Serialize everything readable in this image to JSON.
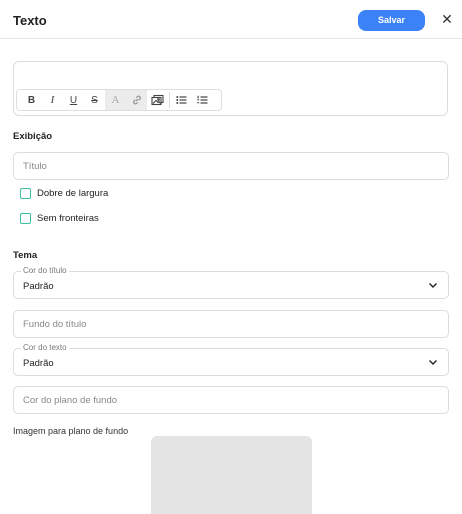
{
  "header": {
    "title": "Texto",
    "save_label": "Salvar",
    "close_glyph": "✕"
  },
  "toolbar": {
    "items": [
      {
        "name": "bold-icon",
        "glyph": "B"
      },
      {
        "name": "italic-icon",
        "glyph": "I"
      },
      {
        "name": "underline-icon",
        "glyph": "U"
      },
      {
        "name": "strikethrough-icon",
        "glyph": "S"
      },
      {
        "name": "text-color-icon",
        "glyph": "A"
      },
      {
        "name": "link-icon",
        "glyph": ""
      },
      {
        "name": "image-icon",
        "glyph": ""
      },
      {
        "name": "bullet-list-icon",
        "glyph": ""
      },
      {
        "name": "numbered-list-icon",
        "glyph": ""
      }
    ]
  },
  "display": {
    "label": "Exibição",
    "title_placeholder": "Título",
    "options": [
      {
        "label": "Dobre de largura",
        "checked": false
      },
      {
        "label": "Sem fronteiras",
        "checked": false
      }
    ]
  },
  "theme": {
    "label": "Tema",
    "title_color": {
      "label": "Cor do título",
      "value": "Padrão"
    },
    "title_background_placeholder": "Fundo do título",
    "text_color": {
      "label": "Cor do texto",
      "value": "Padrão"
    },
    "background_color_placeholder": "Cor do plano de fundo",
    "background_image_label": "Imagem para plano de fundo"
  },
  "colors": {
    "accent": "#3b82f6",
    "checkbox": "#3bbfa1"
  }
}
